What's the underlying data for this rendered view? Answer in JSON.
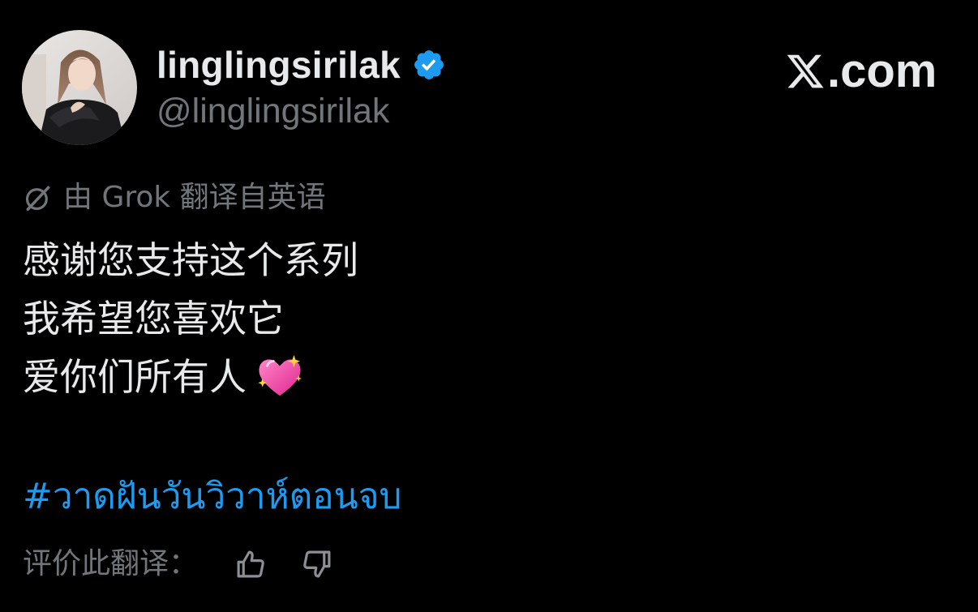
{
  "author": {
    "display_name": "linglingsirilak",
    "handle": "@linglingsirilak",
    "verified": true
  },
  "brand": {
    "label": ".com",
    "icon": "x-logo-icon"
  },
  "translation": {
    "note": "由 Grok 翻译自英语",
    "icon": "grok-icon"
  },
  "tweet": {
    "lines": [
      "感谢您支持这个系列",
      "我希望您喜欢它",
      "爱你们所有人"
    ],
    "emoji": "sparkling-heart",
    "hashtag": "#วาดฝันวันวิวาห์ตอนจบ"
  },
  "rating": {
    "label": "评价此翻译：",
    "up_icon": "thumbs-up-icon",
    "down_icon": "thumbs-down-icon"
  },
  "colors": {
    "background": "#000000",
    "text": "#e7e9ea",
    "muted": "#71767b",
    "link": "#1d9bf0",
    "verified": "#1d9bf0"
  }
}
